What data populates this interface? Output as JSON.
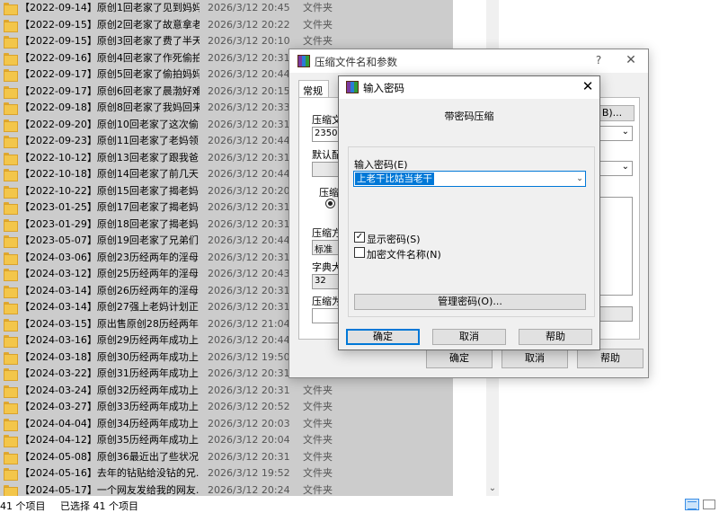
{
  "files": [
    {
      "name": "【2022-09-14】原创1回老家了见到妈妈...",
      "date": "2026/3/12 20:45",
      "type": "文件夹"
    },
    {
      "name": "【2022-09-15】原创2回老家了故意拿老...",
      "date": "2026/3/12 20:22",
      "type": "文件夹"
    },
    {
      "name": "【2022-09-15】原创3回老家了费了半天...",
      "date": "2026/3/12 20:10",
      "type": "文件夹"
    },
    {
      "name": "【2022-09-16】原创4回老家了作死偷拍...",
      "date": "2026/3/12 20:31",
      "type": "文件夹"
    },
    {
      "name": "【2022-09-17】原创5回老家了偷拍妈妈...",
      "date": "2026/3/12 20:44",
      "type": "文件夹"
    },
    {
      "name": "【2022-09-17】原创6回老家了晨渤好难...",
      "date": "2026/3/12 20:15",
      "type": "文件夹"
    },
    {
      "name": "【2022-09-18】原创8回老家了我妈回来...",
      "date": "2026/3/12 20:33",
      "type": "文件夹"
    },
    {
      "name": "【2022-09-20】原创10回老家了这次偷...",
      "date": "2026/3/12 20:31",
      "type": "文件夹"
    },
    {
      "name": "【2022-09-23】原创11回老家了老妈领...",
      "date": "2026/3/12 20:44",
      "type": "文件夹"
    },
    {
      "name": "【2022-10-12】原创13回老家了跟我爸...",
      "date": "2026/3/12 20:31",
      "type": "文件夹"
    },
    {
      "name": "【2022-10-18】原创14回老家了前几天...",
      "date": "2026/3/12 20:44",
      "type": "文件夹"
    },
    {
      "name": "【2022-10-22】原创15回老家了揭老妈...",
      "date": "2026/3/12 20:20",
      "type": "文件夹"
    },
    {
      "name": "【2023-01-25】原创17回老家了揭老妈...",
      "date": "2026/3/12 20:31",
      "type": "文件夹"
    },
    {
      "name": "【2023-01-29】原创18回老家了揭老妈...",
      "date": "2026/3/12 20:31",
      "type": "文件夹"
    },
    {
      "name": "【2023-05-07】原创19回老家了兄弟们...",
      "date": "2026/3/12 20:44",
      "type": "文件夹"
    },
    {
      "name": "【2024-03-06】原创23历经两年的淫母...",
      "date": "2026/3/12 20:31",
      "type": "文件夹"
    },
    {
      "name": "【2024-03-12】原创25历经两年的淫母...",
      "date": "2026/3/12 20:43",
      "type": "文件夹"
    },
    {
      "name": "【2024-03-14】原创26历经两年的淫母...",
      "date": "2026/3/12 20:31",
      "type": "文件夹"
    },
    {
      "name": "【2024-03-14】原创27强上老妈计划正...",
      "date": "2026/3/12 20:31",
      "type": "文件夹"
    },
    {
      "name": "【2024-03-15】原出售原创28历经两年...",
      "date": "2026/3/12 21:04",
      "type": "文件夹"
    },
    {
      "name": "【2024-03-16】原创29历经两年成功上...",
      "date": "2026/3/12 20:44",
      "type": "文件夹"
    },
    {
      "name": "【2024-03-18】原创30历经两年成功上...",
      "date": "2026/3/12 19:50",
      "type": "文件夹"
    },
    {
      "name": "【2024-03-22】原创31历经两年成功上...",
      "date": "2026/3/12 20:31",
      "type": "文件夹"
    },
    {
      "name": "【2024-03-24】原创32历经两年成功上...",
      "date": "2026/3/12 20:31",
      "type": "文件夹"
    },
    {
      "name": "【2024-03-27】原创33历经两年成功上...",
      "date": "2026/3/12 20:52",
      "type": "文件夹"
    },
    {
      "name": "【2024-04-04】原创34历经两年成功上...",
      "date": "2026/3/12 20:03",
      "type": "文件夹"
    },
    {
      "name": "【2024-04-12】原创35历经两年成功上...",
      "date": "2026/3/12 20:04",
      "type": "文件夹"
    },
    {
      "name": "【2024-05-08】原创36最近出了些状况...",
      "date": "2026/3/12 20:31",
      "type": "文件夹"
    },
    {
      "name": "【2024-05-16】去年的钻贴给没钻的兄...",
      "date": "2026/3/12 19:52",
      "type": "文件夹"
    },
    {
      "name": "【2024-05-17】一个网友发给我的网友...",
      "date": "2026/3/12 20:24",
      "type": "文件夹"
    }
  ],
  "status": {
    "count": "41 个项目",
    "selected": "已选择 41 个项目"
  },
  "archive_dialog": {
    "title": "压缩文件名和参数",
    "help_glyph": "?",
    "close_glyph": "✕",
    "tab_general": "常规",
    "archive_name_label": "压缩文",
    "archive_name_value": "235034",
    "browse_label": "B)...",
    "default_profile_label": "默认配",
    "format_label": "压缩",
    "method_label": "压缩方",
    "method_value": "标准",
    "dict_label": "字典大",
    "dict_value": "32",
    "split_label": "压缩为",
    "ok": "确定",
    "cancel": "取消",
    "help": "帮助"
  },
  "password_dialog": {
    "title": "输入密码",
    "close_glyph": "✕",
    "heading": "带密码压缩",
    "input_label": "输入密码(E)",
    "password_value": "上老干比姑当老干",
    "show_password_label": "显示密码(S)",
    "show_password_checked": true,
    "encrypt_names_label": "加密文件名称(N)",
    "encrypt_names_checked": false,
    "manage_button": "管理密码(O)...",
    "ok": "确定",
    "cancel": "取消",
    "help": "帮助"
  },
  "colors": {
    "list_selected_bg": "#cccccc",
    "accent": "#0078d7",
    "folder": "#f3c64a"
  }
}
